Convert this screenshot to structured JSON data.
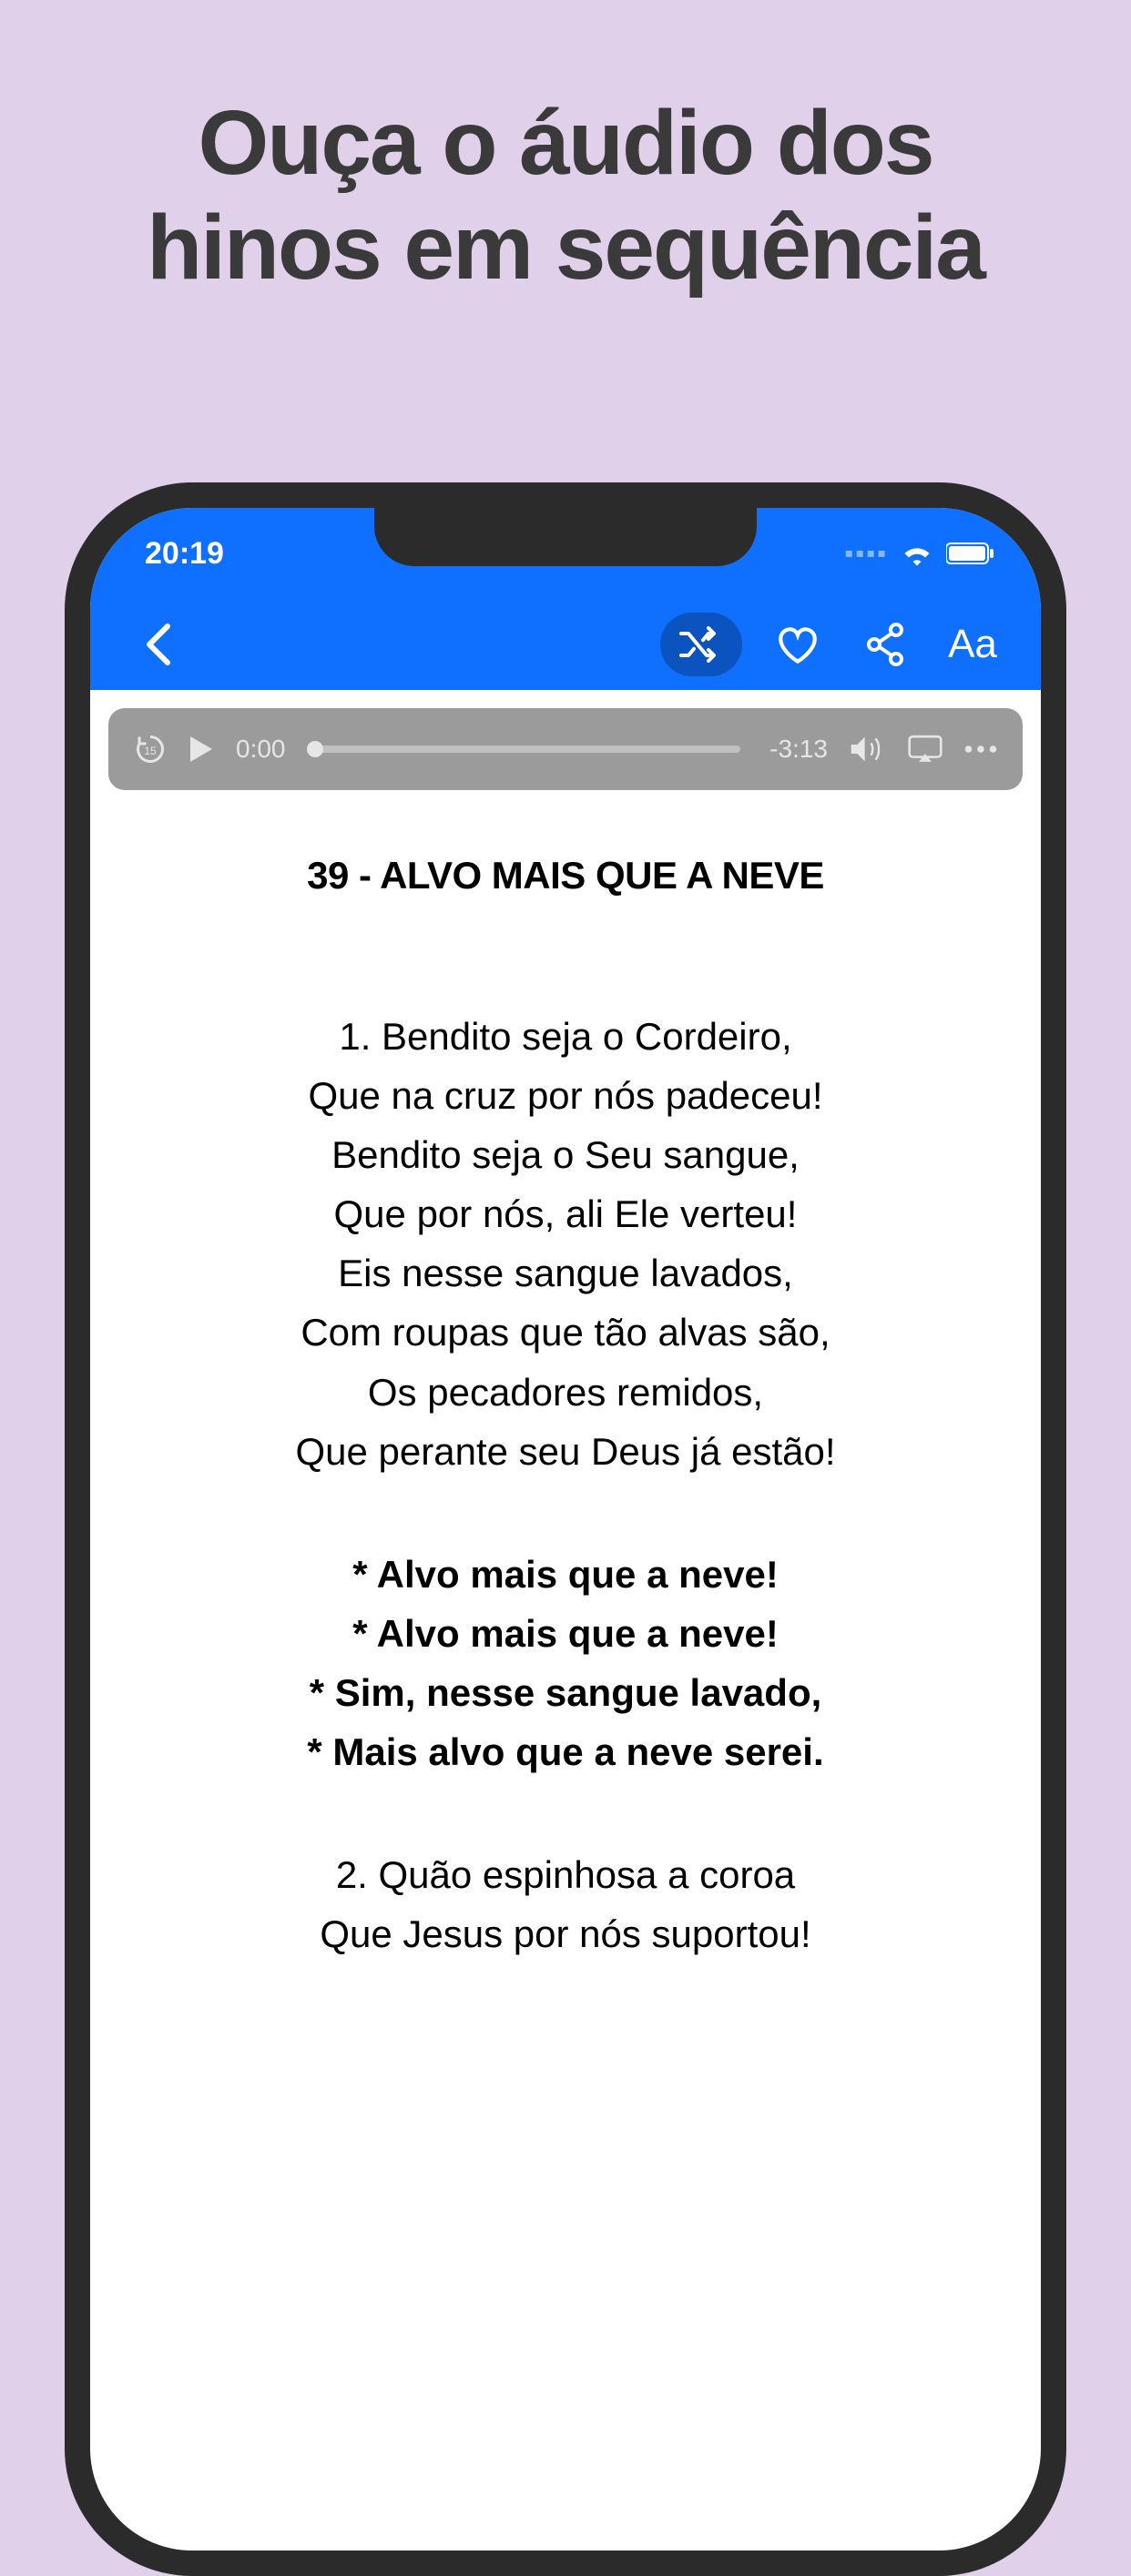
{
  "headline_line1": "Ouça o áudio dos",
  "headline_line2": "hinos em sequência",
  "status": {
    "time": "20:19"
  },
  "nav": {
    "font_label": "Aa"
  },
  "player": {
    "current_time": "0:00",
    "remaining_time": "-3:13"
  },
  "hymn": {
    "title": "39 - ALVO MAIS QUE A NEVE",
    "verse1": [
      "1. Bendito seja o Cordeiro,",
      "Que na cruz por nós padeceu!",
      "Bendito seja o Seu sangue,",
      "Que por nós, ali Ele verteu!",
      "Eis nesse sangue lavados,",
      "Com roupas que tão alvas são,",
      "Os pecadores remidos,",
      "Que perante seu Deus já estão!"
    ],
    "chorus": [
      "* Alvo mais que a neve!",
      "* Alvo mais que a neve!",
      "* Sim, nesse sangue lavado,",
      "* Mais alvo que a neve serei."
    ],
    "verse2": [
      "2. Quão espinhosa a coroa",
      "Que Jesus por nós suportou!"
    ]
  }
}
